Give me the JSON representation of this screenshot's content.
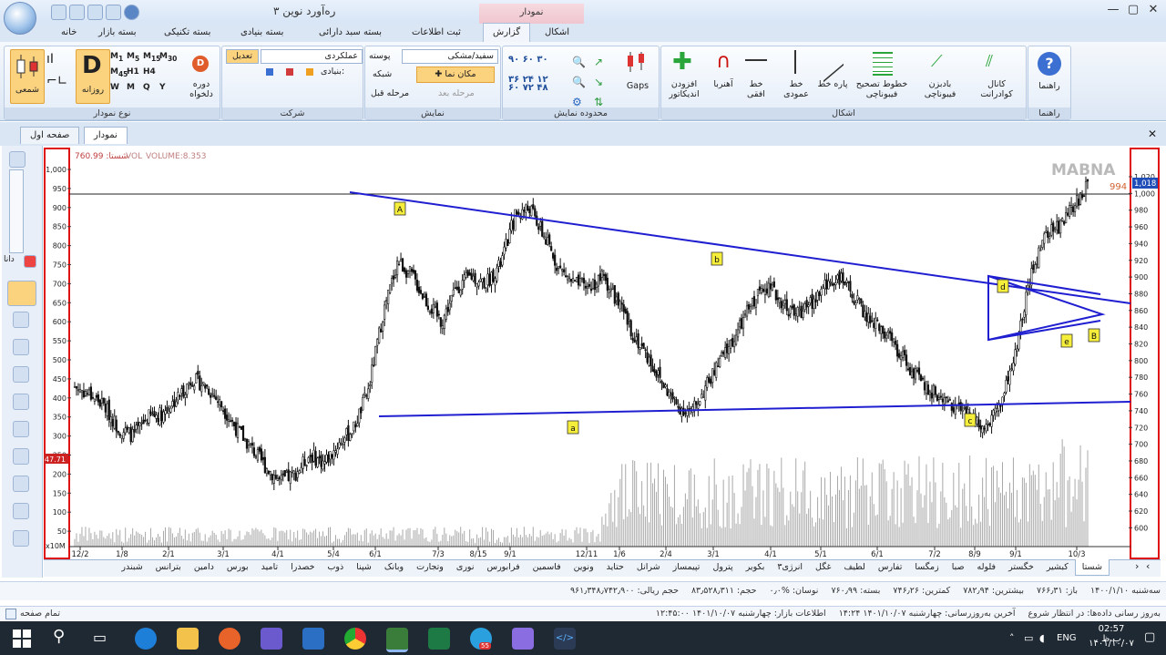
{
  "window": {
    "title": "ره‌آورد نوین ۳",
    "context_tab": "نمودار"
  },
  "ribbon_tabs": [
    {
      "label": "خانه"
    },
    {
      "label": "بسته بازار"
    },
    {
      "label": "بسته تکنیکی"
    },
    {
      "label": "بسته بنیادی"
    },
    {
      "label": "بسته سبد دارائی"
    },
    {
      "label": "ثبت اطلاعات"
    },
    {
      "label": "گزارش"
    },
    {
      "label": "اشکال"
    }
  ],
  "ribbon": {
    "chart_type_group": {
      "label": "نوع نمودار",
      "candle": "شمعی",
      "daily": "روزانه",
      "periodic": "دوره دلخواه",
      "intervals": [
        "1",
        "5",
        "15",
        "30",
        "45",
        "H1",
        "H4",
        "W",
        "M",
        "Q",
        "Y"
      ]
    },
    "company_group": {
      "label": "شرکت",
      "edit": "تعدیل",
      "perf": "عملکردی",
      "fundamental": "بنیادی:"
    },
    "display_group": {
      "label": "نمایش",
      "skin": "سفید/مشکی",
      "skin_label": "پوسته",
      "cursor": "مکان نما",
      "grid": "شبکه",
      "next": "مرحله بعد",
      "prev": "مرحله قبل"
    },
    "range_group": {
      "label": "محدوده نمایش",
      "values": [
        "۹۰",
        "۶۰",
        "۳۰",
        "۳۶",
        "۲۴",
        "۱۲",
        "۶۰",
        "۷۲",
        "۴۸"
      ],
      "gaps": "Gaps"
    },
    "shapes_group": {
      "label": "اشکال",
      "add_indicator": "افزودن اندیکاتور",
      "magnet": "آهنربا",
      "hline": "خط افقی",
      "vline": "خط عمودی",
      "segment": "پاره خط",
      "fib_fix": "خطوط تصحیح فیبوناچی",
      "fib_fan": "بادبزن فیبوناچی",
      "quad": "کانال کوادرانت"
    },
    "help_group": {
      "label": "راهنما",
      "help": "راهنما"
    }
  },
  "doc_tabs": [
    {
      "label": "نمودار"
    },
    {
      "label": "صفحه اول"
    }
  ],
  "chart_header": {
    "price_label": "شستا:",
    "price_value": "760.99",
    "vol_label": "VOL",
    "volume_label": "VOLUME:8.353",
    "watermark": "MABNA"
  },
  "chart_data": {
    "type": "candlestick",
    "left_axis_ticks": [
      "1,000",
      "950",
      "900",
      "850",
      "800",
      "750",
      "700",
      "650",
      "600",
      "550",
      "500",
      "450",
      "400",
      "350",
      "300",
      "250",
      "200",
      "150",
      "100",
      "50"
    ],
    "right_axis_ticks": [
      "1,020",
      "1,000",
      "980",
      "960",
      "940",
      "920",
      "900",
      "880",
      "860",
      "840",
      "820",
      "800",
      "780",
      "760",
      "740",
      "720",
      "700",
      "680",
      "660",
      "640",
      "620",
      "600"
    ],
    "x_ticks": [
      "12/2",
      "1/8",
      "2/1",
      "3/1",
      "4/1",
      "5/4",
      "6/1",
      "7/3",
      "8/15",
      "9/1",
      "12/11",
      "1/6",
      "2/4",
      "3/1",
      "4/1",
      "5/1",
      "6/1",
      "7/2",
      "8/9",
      "9/1",
      "10/3"
    ],
    "last_price_tag": "1,018",
    "level_label": "994",
    "left_marker": "47.71",
    "vol_scale": "x10M",
    "wave_labels": [
      "A",
      "b",
      "a",
      "c",
      "d",
      "e",
      "B"
    ],
    "close_series": [
      430,
      410,
      380,
      320,
      300,
      350,
      360,
      400,
      450,
      430,
      380,
      320,
      270,
      220,
      180,
      200,
      250,
      230,
      280,
      320,
      420,
      620,
      760,
      720,
      650,
      600,
      690,
      720,
      700,
      750,
      880,
      900,
      820,
      740,
      700,
      690,
      720,
      650,
      570,
      510,
      440,
      380,
      360,
      430,
      500,
      560,
      640,
      700,
      660,
      620,
      640,
      690,
      720,
      670,
      610,
      580,
      530,
      470,
      430,
      400,
      380,
      350,
      330,
      380,
      500,
      700,
      820,
      850,
      900,
      960
    ]
  },
  "stock_tabs": [
    "شستا",
    "کبشیر",
    "خگستر",
    "فلوله",
    "صبا",
    "زمگسا",
    "تفارس",
    "لطیف",
    "غگل",
    "انرژی۳",
    "بکویر",
    "پترول",
    "تپیمساز",
    "شرانل",
    "حتاید",
    "ونوین",
    "فاسمین",
    "فرابورس",
    "نوری",
    "وتجارت",
    "وبانک",
    "شپنا",
    "ذوب",
    "خصدرا",
    "تامید",
    "بورس",
    "دامین",
    "بترانس",
    "شبندر"
  ],
  "status": {
    "line1": [
      "سه‌شنبه ۱۴۰۰/۱/۱۰",
      "باز: ۷۶۶٫۳۱",
      "بیشترین: ۷۸۲٫۹۴",
      "کمترین: ۷۴۶٫۲۶",
      "بسته: ۷۶۰٫۹۹",
      "نوسان: %۰٫۰",
      "حجم: ۸۳٫۵۲۸٫۳۱۱",
      "حجم ریالی: ۹۶۱٫۳۴۸٫۷۴۲٫۹۰۰"
    ],
    "line2_left": "تمام صفحه",
    "line2": [
      "به‌روز رسانی داده‌ها: در انتظار شروع",
      "آخرین به‌روزرسانی: چهارشنبه ۱۴۰۱/۱۰/۰۷ ۱۴:۲۴",
      "اطلاعات بازار: چهارشنبه ۱۴۰۱/۱۰/۰۷ ۱۲:۴۵:۰۰"
    ]
  },
  "taskbar": {
    "lang": "ENG",
    "time": "02:57 ب.ظ",
    "date": "۱۴۰۱/۱۰/۰۷",
    "badge": "55"
  }
}
